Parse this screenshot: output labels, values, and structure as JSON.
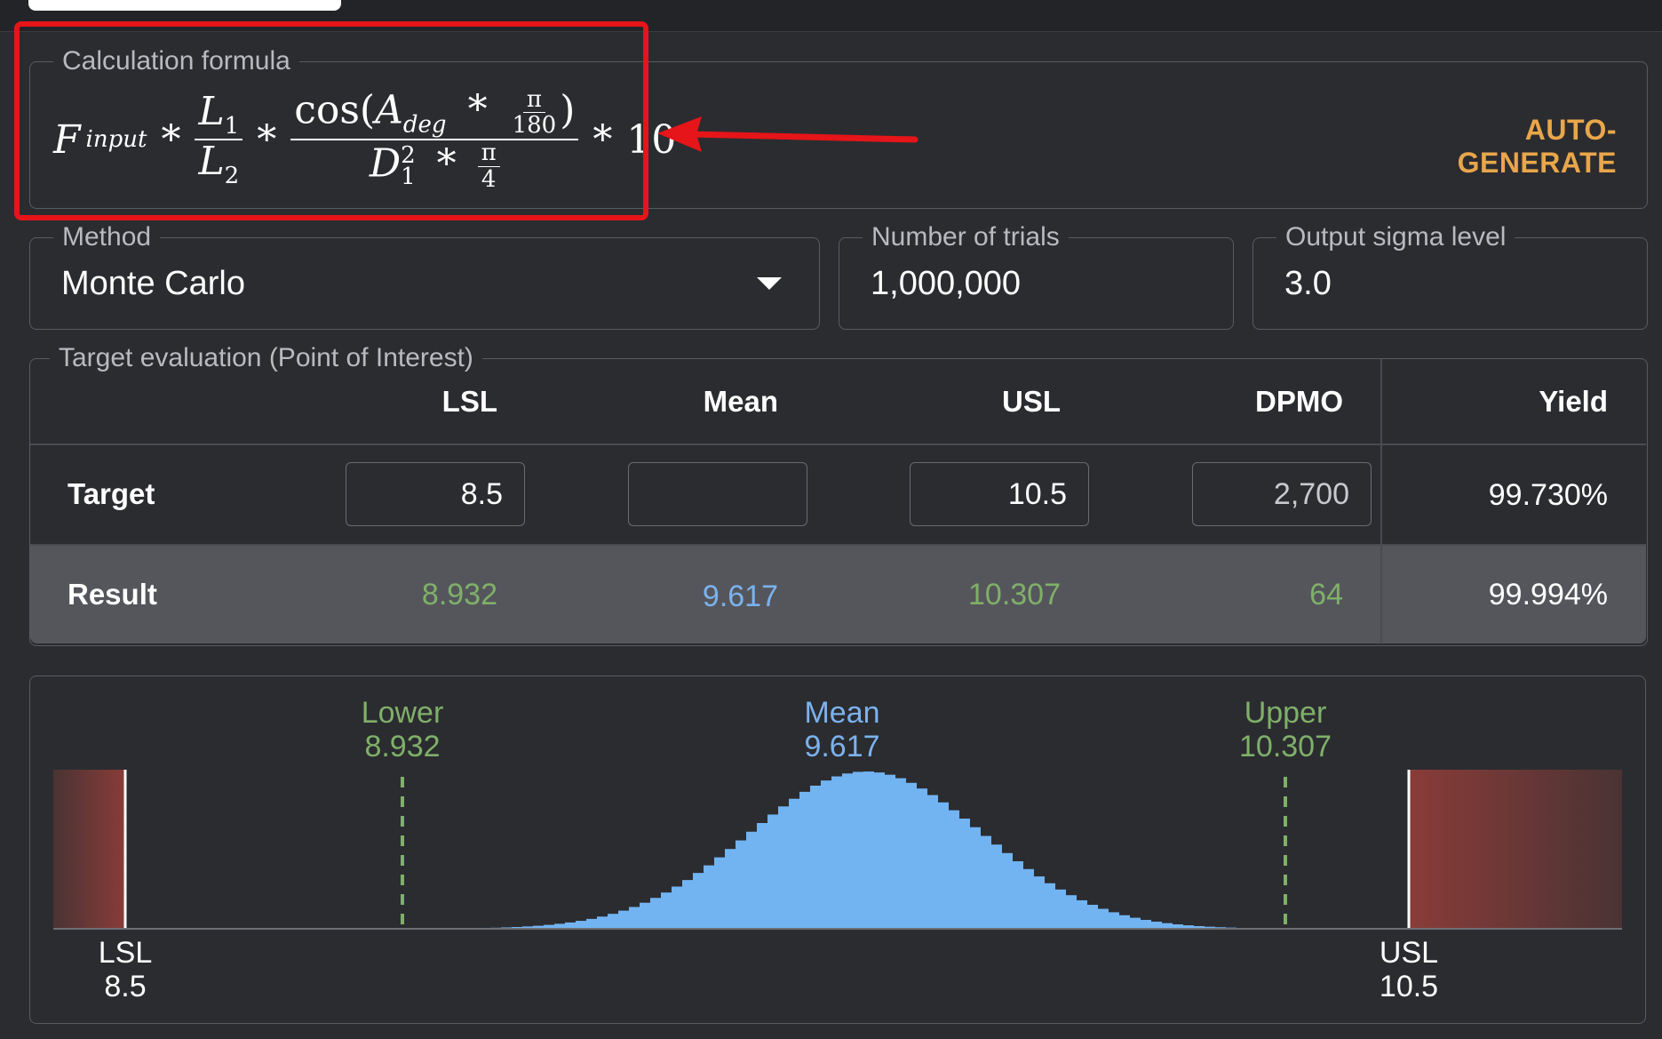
{
  "formula_panel": {
    "legend": "Calculation formula",
    "auto_generate_label": "AUTO-GENERATE",
    "formula": {
      "f_var": "F",
      "f_sub": "input",
      "op": "*",
      "l1": "L",
      "l1_sub": "1",
      "l2": "L",
      "l2_sub": "2",
      "cos": "cos(",
      "a_var": "A",
      "a_sub": "deg",
      "pi": "π",
      "d180": "180",
      "close_paren": ")",
      "d_var": "D",
      "d_sup": "2",
      "d_sub": "1",
      "d4": "4",
      "tail": "10"
    }
  },
  "method": {
    "legend": "Method",
    "value": "Monte Carlo"
  },
  "trials": {
    "legend": "Number of trials",
    "value": "1,000,000"
  },
  "sigma": {
    "legend": "Output sigma level",
    "value": "3.0"
  },
  "target_eval": {
    "legend": "Target evaluation (Point of Interest)",
    "columns": [
      "LSL",
      "Mean",
      "USL",
      "DPMO",
      "Yield"
    ],
    "target_row": {
      "label": "Target",
      "lsl": "8.5",
      "mean": "",
      "usl": "10.5",
      "dpmo": "2,700",
      "yield": "99.730%"
    },
    "result_row": {
      "label": "Result",
      "lsl": "8.932",
      "mean": "9.617",
      "usl": "10.307",
      "dpmo": "64",
      "yield": "99.994%"
    }
  },
  "distribution": {
    "lower_label": "Lower",
    "lower_value": "8.932",
    "mean_label": "Mean",
    "mean_value": "9.617",
    "upper_label": "Upper",
    "upper_value": "10.307",
    "lsl_label": "LSL",
    "lsl_value": "8.5",
    "usl_label": "USL",
    "usl_value": "10.5"
  },
  "chart_data": {
    "type": "area",
    "title": "",
    "distribution": "normal histogram",
    "mean": 9.617,
    "lower": 8.932,
    "upper": 10.307,
    "lsl": 8.5,
    "usl": 10.5,
    "xlim": [
      8.42,
      10.73
    ]
  },
  "colors": {
    "accent_orange": "#e9a64a",
    "green": "#7fb069",
    "blue": "#7bb2ee",
    "highlight_red": "#e51519",
    "histogram": "#72b4f2"
  }
}
